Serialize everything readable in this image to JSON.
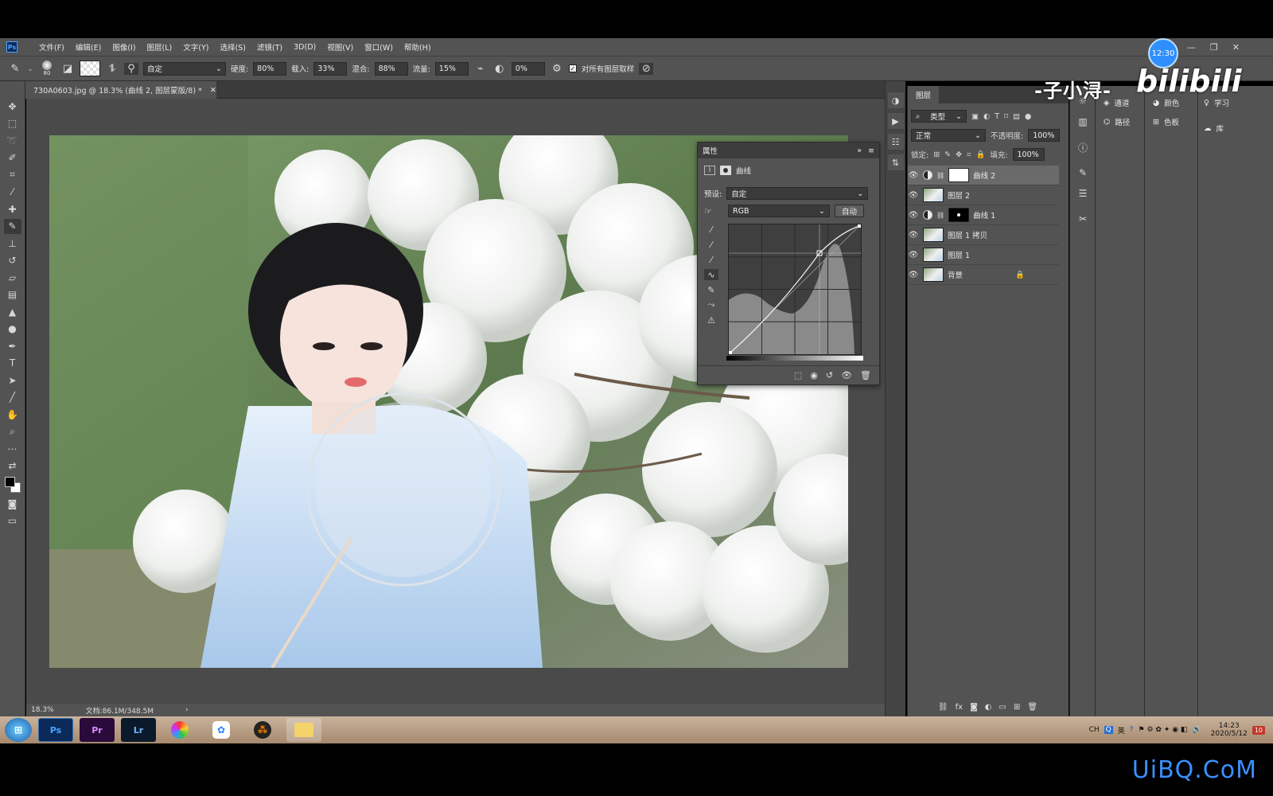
{
  "menubar": {
    "logo": "Ps",
    "items": [
      "文件(F)",
      "编辑(E)",
      "图像(I)",
      "图层(L)",
      "文字(Y)",
      "选择(S)",
      "滤镜(T)",
      "3D(D)",
      "视图(V)",
      "窗口(W)",
      "帮助(H)"
    ]
  },
  "options": {
    "brush_size": "80",
    "preset": "自定",
    "hardness_label": "硬度:",
    "hardness": "80%",
    "load_label": "载入:",
    "load": "33%",
    "mix_label": "混合:",
    "mix": "88%",
    "flow_label": "流量:",
    "flow": "15%",
    "angle": "0%",
    "sample_all_label": "对所有图层取样"
  },
  "document": {
    "tab_title": "730A0603.jpg @ 18.3% (曲线 2, 图层蒙版/8) *",
    "zoom": "18.3%",
    "doc_size": "文档:86.1M/348.5M"
  },
  "properties": {
    "title": "属性",
    "adjustment_name": "曲线",
    "preset_label": "预设:",
    "preset_value": "自定",
    "channel": "RGB",
    "auto_label": "自动"
  },
  "layers_panel": {
    "tab": "图层",
    "filter_kind": "类型",
    "blend_mode": "正常",
    "opacity_label": "不透明度:",
    "opacity": "100%",
    "lock_label": "锁定:",
    "fill_label": "填充:",
    "fill": "100%",
    "layers": [
      {
        "name": "曲线 2",
        "type": "adjustment",
        "mask": "white",
        "selected": true
      },
      {
        "name": "图层 2",
        "type": "pixel",
        "selected": false
      },
      {
        "name": "曲线 1",
        "type": "adjustment",
        "mask": "dark",
        "selected": false
      },
      {
        "name": "图层 1 拷贝",
        "type": "pixel",
        "selected": false
      },
      {
        "name": "图层 1",
        "type": "pixel",
        "selected": false
      },
      {
        "name": "背景",
        "type": "pixel",
        "locked": true,
        "selected": false
      }
    ]
  },
  "side_panels": {
    "channels": "通道",
    "paths": "路径",
    "color": "颜色",
    "swatches": "色板",
    "learn": "学习",
    "libraries": "库"
  },
  "watermark": {
    "author": "-子小浔-",
    "brand": "bilibili"
  },
  "clock_badge": "12:30",
  "taskbar": {
    "apps": [
      "Ps",
      "Pr",
      "Lr"
    ],
    "tray_lang": "CH",
    "tray_ime": "英",
    "time": "14:23",
    "date": "2020/5/12",
    "notif_count": "10"
  },
  "site_watermark": "UiBQ.CoM",
  "colors": {
    "ps_panel": "#535353",
    "ps_dark": "#3b3b3b",
    "accent_blue": "#3a90ff"
  }
}
